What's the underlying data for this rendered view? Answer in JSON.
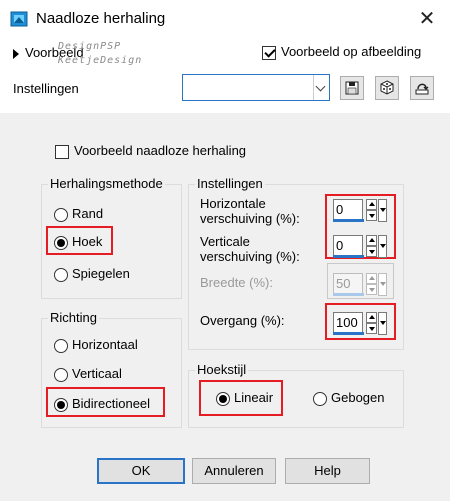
{
  "window": {
    "title": "Naadloze herhaling",
    "close": "✕"
  },
  "top": {
    "preview_toggle": "Voorbeeld",
    "watermark_line1": "DesignPSP",
    "watermark_line2": "KeetjeDesign",
    "preview_on_image": "Voorbeeld op afbeelding",
    "preview_on_image_checked": true,
    "settings_label": "Instellingen",
    "preset_value": ""
  },
  "options": {
    "seamless_preview": "Voorbeeld naadloze herhaling",
    "seamless_preview_checked": false
  },
  "method": {
    "title": "Herhalingsmethode",
    "options": [
      "Rand",
      "Hoek",
      "Spiegelen"
    ],
    "selected": "Hoek"
  },
  "direction": {
    "title": "Richting",
    "options": [
      "Horizontaal",
      "Verticaal",
      "Bidirectioneel"
    ],
    "selected": "Bidirectioneel"
  },
  "settings": {
    "title": "Instellingen",
    "h_shift_label": "Horizontale verschuiving (%):",
    "h_shift_value": "0",
    "v_shift_label": "Verticale verschuiving (%):",
    "v_shift_value": "0",
    "width_label": "Breedte (%):",
    "width_value": "50",
    "transition_label": "Overgang (%):",
    "transition_value": "100"
  },
  "corner": {
    "title": "Hoekstijl",
    "options": [
      "Lineair",
      "Gebogen"
    ],
    "selected": "Lineair"
  },
  "buttons": {
    "ok": "OK",
    "cancel": "Annuleren",
    "help": "Help"
  },
  "icons": {
    "app": "seamless-tiling-app-icon",
    "save": "save-preset-icon",
    "random": "randomize-dice-icon",
    "reset": "reset-icon"
  },
  "colors": {
    "highlight": "#e51d23",
    "accent": "#2a74c8",
    "panel": "#f0f0f0"
  }
}
